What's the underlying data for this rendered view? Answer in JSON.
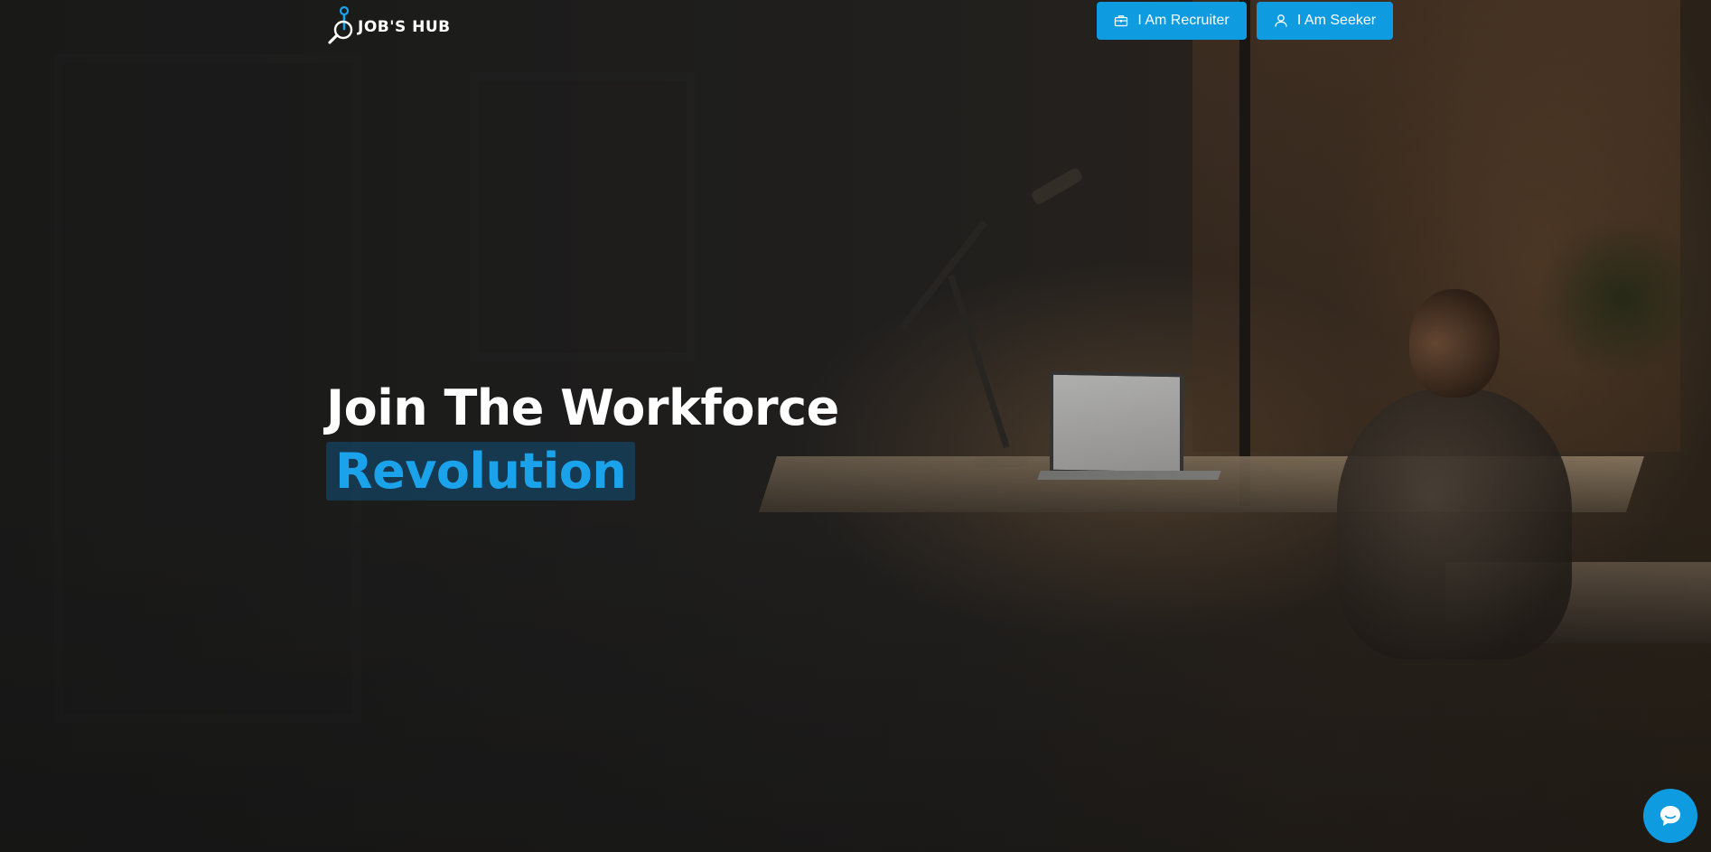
{
  "header": {
    "logo_text": "JOB'S HUB",
    "logo_icon": "person-search-icon",
    "buttons": [
      {
        "label": "I Am Recruiter",
        "icon": "briefcase-icon"
      },
      {
        "label": "I Am Seeker",
        "icon": "user-icon"
      }
    ]
  },
  "hero": {
    "title_line1": "Join The Workforce",
    "title_highlight": "Revolution"
  },
  "chat": {
    "icon": "chat-bubble-icon"
  },
  "colors": {
    "accent": "#0f9be0",
    "highlight_text": "#1aa3eb",
    "highlight_bg": "#154362",
    "text": "#ffffff"
  }
}
